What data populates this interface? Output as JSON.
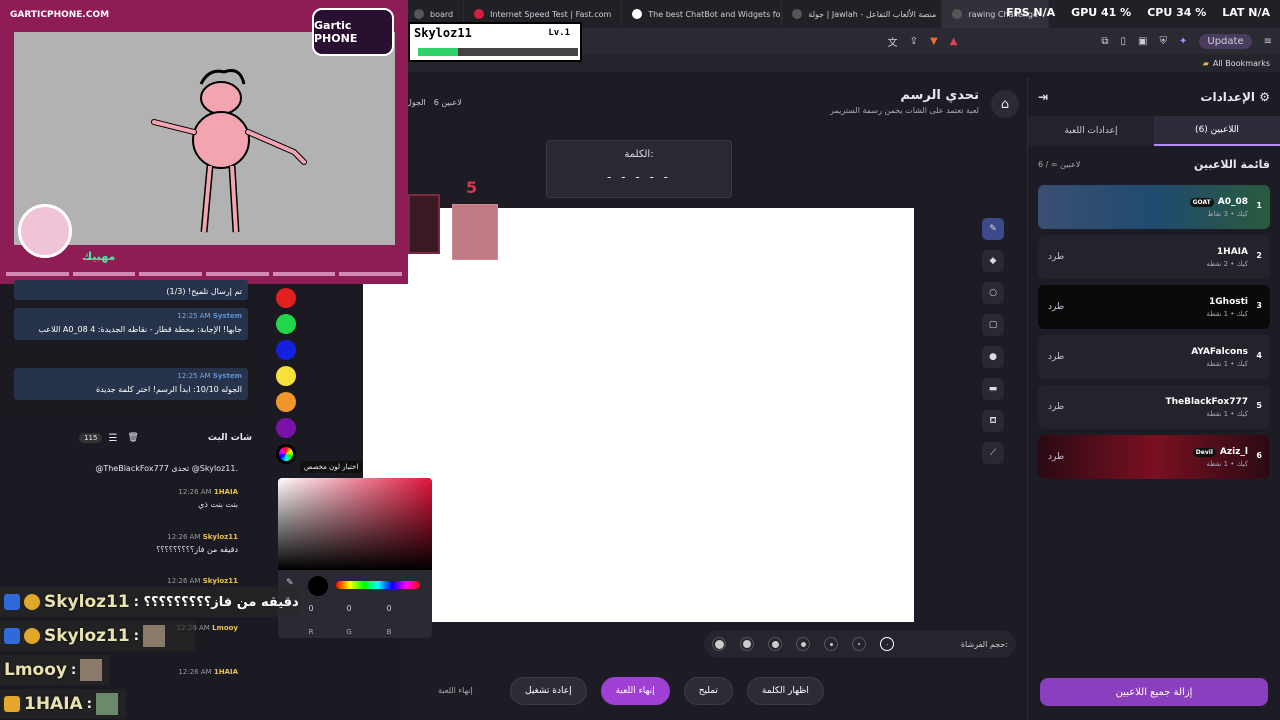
{
  "browser": {
    "tabs": [
      {
        "label": "board"
      },
      {
        "label": "Internet Speed Test | Fast.com"
      },
      {
        "label": "The best ChatBot and Widgets for K"
      },
      {
        "label": "جولة | Jawlah - منصة الألعاب التفاعل"
      },
      {
        "label": "rawing Challenge"
      }
    ],
    "perf": {
      "fps": "FPS N/A",
      "gpu": "GPU 41 %",
      "cpu": "CPU 34 %",
      "lat": "LAT N/A"
    },
    "update_label": "Update",
    "bookmarks_label": "All Bookmarks"
  },
  "stream": {
    "url": "GARTICPHONE.COM",
    "logo": "Gartic PHONE",
    "streamer": "مهبيك",
    "level_name": "Skyloz11",
    "level": "Lv.1",
    "level_progress": 0.25
  },
  "game": {
    "title": "تحدي الرسم",
    "subtitle": "لعبة تعتمد على الشات يخمن رسمة الستريمر",
    "players_count": "6 لاعبين",
    "round_label": "الجول",
    "word_label": "الكلمة:",
    "word_mask": "- - - - -",
    "timer": "5",
    "brush_label": "حجم الفرشاة:",
    "tooltip": "اختيار لون مخصص",
    "end_label": "إنهاء اللعبة",
    "buttons": {
      "restart": "إعادة تشغيل",
      "end_game": "إنهاء اللعبة",
      "hint": "تمليح",
      "reveal": "اظهار الكلمة"
    },
    "palette": [
      "#e32020",
      "#22d64a",
      "#1320e0",
      "#f4e13a",
      "#f2962b",
      "#7a12a8",
      "#000000"
    ],
    "picker": {
      "r": "0",
      "g": "0",
      "b": "0",
      "r_label": "R",
      "g_label": "G",
      "b_label": "B"
    }
  },
  "settings": {
    "title": "الإعدادات",
    "tabs": {
      "players": "اللاعبين (6)",
      "game": "إعدادات اللعبة"
    },
    "list_title": "قائمة اللاعبين",
    "list_count": "6 / ∞ لاعبين",
    "kick": "طرد",
    "players": [
      {
        "rank": "1",
        "name": "A0_08",
        "tag": "GOAT",
        "pts": "كيك • 3 نقاط"
      },
      {
        "rank": "2",
        "name": "1HAIA",
        "pts": "كيك • 2 نقطة"
      },
      {
        "rank": "3",
        "name": "1Ghosti",
        "pts": "كيك • 1 نقطة"
      },
      {
        "rank": "4",
        "name": "AYAFalcons",
        "pts": "كيك • 1 نقطة"
      },
      {
        "rank": "5",
        "name": "TheBlackFox777",
        "pts": "كيك • 1 نقطة"
      },
      {
        "rank": "6",
        "name": "Aziz_l",
        "tag": "Devil",
        "pts": "كيك • 1 نقطة"
      }
    ],
    "remove_all": "إزالة جميع اللاعبين"
  },
  "chat": {
    "hint_sent": "تم إرسال تلميح! (1/3)",
    "system_msgs": [
      {
        "sender": "System",
        "time": "12:25 AM",
        "text": "اللاعب A0_08 جابها! الإجابة: محطة قطار - نقاطه الجديدة: 4"
      },
      {
        "sender": "System",
        "time": "12:25 AM",
        "text": "الجوله 10/10: ابدأ الرسم! اختر كلمة جديدة"
      }
    ],
    "title": "شات البث",
    "count": "115",
    "messages": [
      {
        "sender": "",
        "time": "",
        "text": "@TheBlackFox777 تحدى @Skyloz11."
      },
      {
        "sender": "1HAIA",
        "time": "12:26 AM",
        "text": "بنت بنت ذي"
      },
      {
        "sender": "Skyloz11",
        "time": "12:26 AM",
        "text": "دقيقه من فاز؟؟؟؟؟؟؟؟؟"
      },
      {
        "sender": "Skyloz11",
        "time": "12:26 AM",
        "text": ""
      },
      {
        "sender": "Lmooy",
        "time": "12:26 AM",
        "text": ""
      },
      {
        "sender": "1HAIA",
        "time": "12:26 AM",
        "text": ""
      }
    ],
    "overlay": [
      {
        "name": "Skyloz11",
        "text": ": دقيقه من فاز؟؟؟؟؟؟؟؟؟"
      },
      {
        "name": "Skyloz11",
        "text": ":"
      },
      {
        "name": "Lmooy",
        "text": ":"
      },
      {
        "name": "1HAIA",
        "text": ":"
      }
    ]
  }
}
